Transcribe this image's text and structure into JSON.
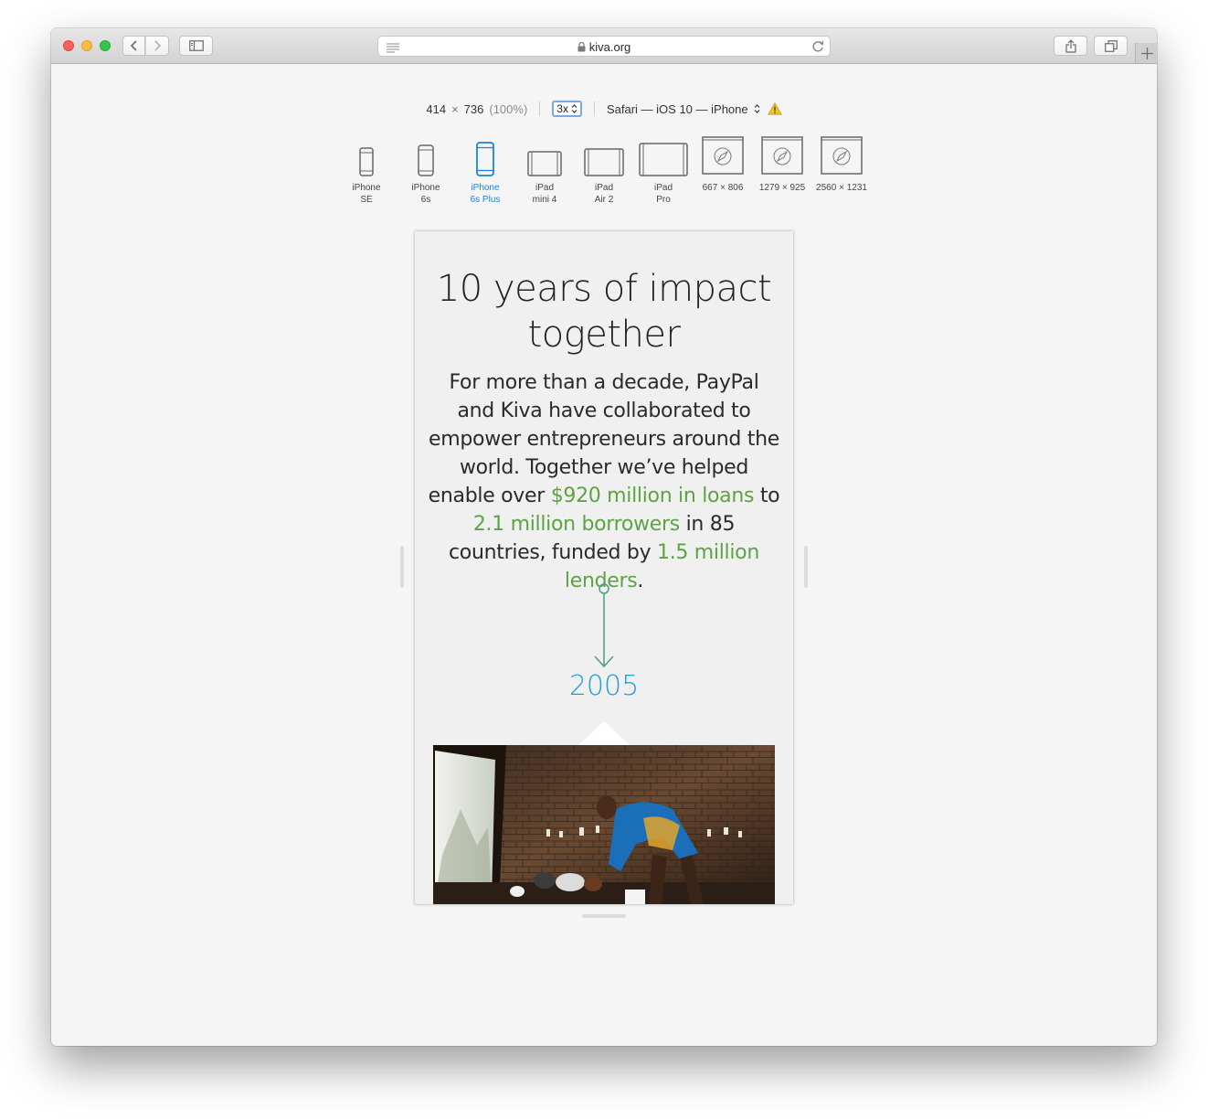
{
  "browser": {
    "url": "kiva.org"
  },
  "responsive": {
    "width": "414",
    "times": "×",
    "height": "736",
    "zoom": "(100%)",
    "scale": "3x",
    "user_agent": "Safari — iOS 10 — iPhone"
  },
  "devices": [
    {
      "line1": "iPhone",
      "line2": "SE",
      "active": false
    },
    {
      "line1": "iPhone",
      "line2": "6s",
      "active": false
    },
    {
      "line1": "iPhone",
      "line2": "6s Plus",
      "active": true
    },
    {
      "line1": "iPad",
      "line2": "mini 4",
      "active": false
    },
    {
      "line1": "iPad",
      "line2": "Air 2",
      "active": false
    },
    {
      "line1": "iPad",
      "line2": "Pro",
      "active": false
    },
    {
      "label": "667 × 806"
    },
    {
      "label": "1279 × 925"
    },
    {
      "label": "2560 × 1231"
    }
  ],
  "page": {
    "title_line1": "10 years of impact",
    "title_line2": "together",
    "intro": {
      "t1": "For more than a decade, PayPal and Kiva have collaborated to empower entrepreneurs around the world. Together we’ve helped enable over ",
      "h1": "$920 million in loans",
      "t2": " to ",
      "h2": "2.1 million borrowers",
      "t3": " in 85 countries, funded by ",
      "h3": "1.5 million lenders",
      "t4": "."
    },
    "year": "2005"
  },
  "colors": {
    "highlight_green": "#5da344",
    "year_blue": "#1f9fd4",
    "arrow_teal": "#4f9c8a",
    "active_device_blue": "#1a82e2"
  }
}
